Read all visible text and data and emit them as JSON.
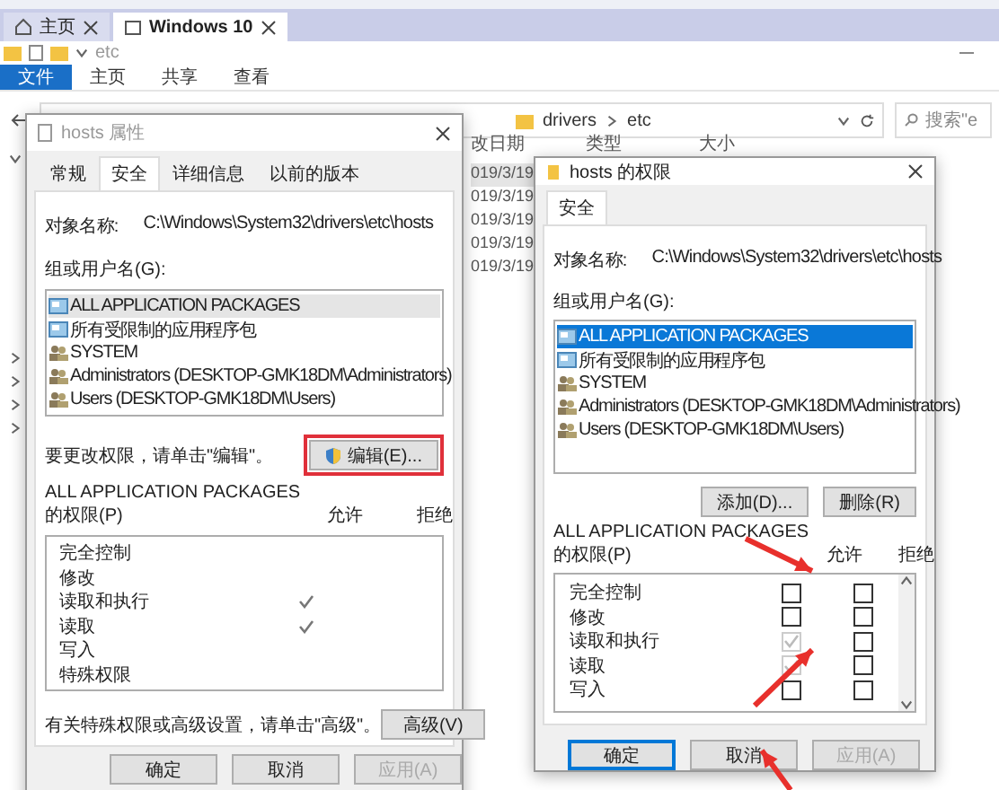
{
  "explorer": {
    "tabs": [
      {
        "label": "主页",
        "selected": false
      },
      {
        "label": "Windows 10",
        "selected": true
      }
    ],
    "title": "etc",
    "ribbon_tabs": [
      {
        "label": "文件",
        "selected": true
      },
      {
        "label": "主页",
        "selected": false
      },
      {
        "label": "共享",
        "selected": false
      },
      {
        "label": "查看",
        "selected": false
      }
    ],
    "breadcrumbs": [
      "drivers",
      "etc"
    ],
    "search": {
      "placeholder": "搜索\"e"
    },
    "columns": [
      "改日期",
      "类型",
      "大小"
    ],
    "rows": [
      "019/3/19",
      "019/3/19",
      "019/3/19",
      "019/3/19",
      "019/3/19"
    ]
  },
  "properties_dialog": {
    "title": "hosts 属性",
    "tabs": [
      {
        "label": "常规",
        "selected": false
      },
      {
        "label": "安全",
        "selected": true
      },
      {
        "label": "详细信息",
        "selected": false
      },
      {
        "label": "以前的版本",
        "selected": false
      }
    ],
    "object_label": "对象名称:",
    "object_value": "C:\\Windows\\System32\\drivers\\etc\\hosts",
    "groups_label": "组或用户名(G):",
    "groups": [
      {
        "name": "ALL APPLICATION PACKAGES",
        "kind": "package",
        "selected": true
      },
      {
        "name": "所有受限制的应用程序包",
        "kind": "package",
        "selected": false
      },
      {
        "name": "SYSTEM",
        "kind": "user",
        "selected": false
      },
      {
        "name": "Administrators (DESKTOP-GMK18DM\\Administrators)",
        "kind": "user",
        "selected": false
      },
      {
        "name": "Users (DESKTOP-GMK18DM\\Users)",
        "kind": "user",
        "selected": false
      }
    ],
    "edit_hint": "要更改权限，请单击\"编辑\"。",
    "edit_button": "编辑(E)...",
    "perm_title": "ALL APPLICATION PACKAGES",
    "perm_label": "的权限(P)",
    "allow_label": "允许",
    "deny_label": "拒绝",
    "permissions": [
      {
        "label": "完全控制",
        "allow": false,
        "deny": false
      },
      {
        "label": "修改",
        "allow": false,
        "deny": false
      },
      {
        "label": "读取和执行",
        "allow": true,
        "deny": false
      },
      {
        "label": "读取",
        "allow": true,
        "deny": false
      },
      {
        "label": "写入",
        "allow": false,
        "deny": false
      },
      {
        "label": "特殊权限",
        "allow": false,
        "deny": false
      }
    ],
    "advanced_hint": "有关特殊权限或高级设置，请单击\"高级\"。",
    "advanced_button": "高级(V)",
    "buttons": [
      {
        "label": "确定",
        "disabled": false,
        "focused": false
      },
      {
        "label": "取消",
        "disabled": false,
        "focused": false
      },
      {
        "label": "应用(A)",
        "disabled": true,
        "focused": false
      }
    ]
  },
  "permissions_dialog": {
    "title": "hosts 的权限",
    "tabs": [
      {
        "label": "安全",
        "selected": true
      }
    ],
    "object_label": "对象名称:",
    "object_value": "C:\\Windows\\System32\\drivers\\etc\\hosts",
    "groups_label": "组或用户名(G):",
    "groups": [
      {
        "name": "ALL APPLICATION PACKAGES",
        "kind": "package",
        "selected": true
      },
      {
        "name": "所有受限制的应用程序包",
        "kind": "package",
        "selected": false
      },
      {
        "name": "SYSTEM",
        "kind": "user",
        "selected": false
      },
      {
        "name": "Administrators (DESKTOP-GMK18DM\\Administrators)",
        "kind": "user",
        "selected": false
      },
      {
        "name": "Users (DESKTOP-GMK18DM\\Users)",
        "kind": "user",
        "selected": false
      }
    ],
    "add_button": "添加(D)...",
    "remove_button": "删除(R)",
    "perm_title": "ALL APPLICATION PACKAGES",
    "perm_label": "的权限(P)",
    "allow_label": "允许",
    "deny_label": "拒绝",
    "permissions": [
      {
        "label": "完全控制",
        "allow": {
          "checked": false,
          "disabled": false
        },
        "deny": {
          "checked": false,
          "disabled": false
        }
      },
      {
        "label": "修改",
        "allow": {
          "checked": false,
          "disabled": false
        },
        "deny": {
          "checked": false,
          "disabled": false
        }
      },
      {
        "label": "读取和执行",
        "allow": {
          "checked": true,
          "disabled": true
        },
        "deny": {
          "checked": false,
          "disabled": false
        }
      },
      {
        "label": "读取",
        "allow": {
          "checked": true,
          "disabled": true
        },
        "deny": {
          "checked": false,
          "disabled": false
        }
      },
      {
        "label": "写入",
        "allow": {
          "checked": false,
          "disabled": false
        },
        "deny": {
          "checked": false,
          "disabled": false
        }
      }
    ],
    "buttons": [
      {
        "label": "确定",
        "disabled": false,
        "focused": true
      },
      {
        "label": "取消",
        "disabled": false,
        "focused": false
      },
      {
        "label": "应用(A)",
        "disabled": true,
        "focused": false
      }
    ]
  }
}
